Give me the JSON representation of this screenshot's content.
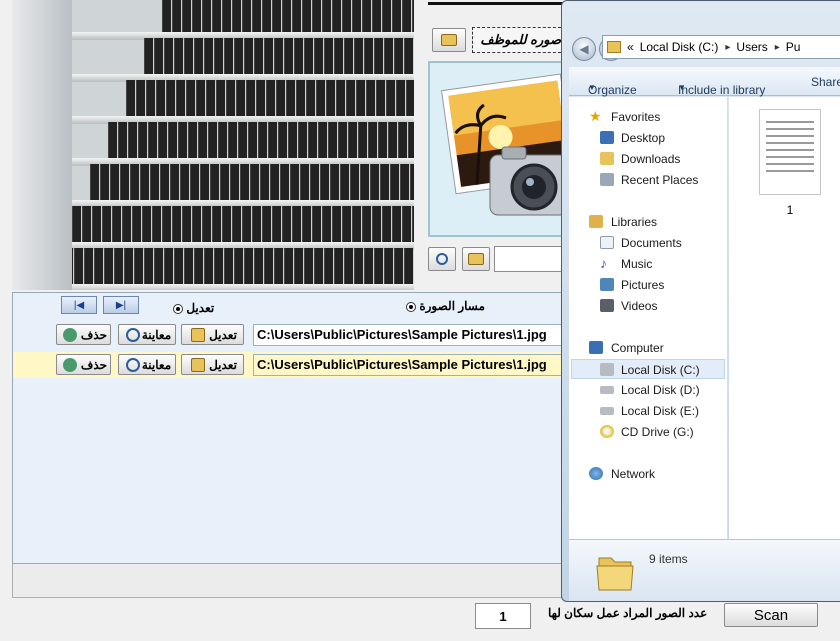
{
  "app": {
    "caption_text": "صوره للموظف",
    "nav_first": "|◀",
    "nav_last": "▶|",
    "radio_edit_label": "تعديل",
    "radio_path_label": "مسار الصورة",
    "rows": [
      {
        "edit": "تعديل",
        "preview": "معاينة",
        "delete": "حذف",
        "path": "C:\\Users\\Public\\Pictures\\Sample Pictures\\1.jpg"
      },
      {
        "edit": "تعديل",
        "preview": "معاينة",
        "delete": "حذف",
        "path": "C:\\Users\\Public\\Pictures\\Sample Pictures\\1.jpg"
      }
    ],
    "scan_count_label": "عدد الصور المراد عمل سكان لها",
    "scan_count_value": "1",
    "scan_button": "Scan"
  },
  "explorer": {
    "address": {
      "prefix": "«",
      "segments": [
        "Local Disk (C:)",
        "Users",
        "Pu"
      ]
    },
    "toolbar": {
      "organize": "Organize",
      "include_in_library": "Include in library",
      "share": "Share"
    },
    "nav": {
      "favorites": "Favorites",
      "favorites_items": [
        "Desktop",
        "Downloads",
        "Recent Places"
      ],
      "libraries": "Libraries",
      "libraries_items": [
        "Documents",
        "Music",
        "Pictures",
        "Videos"
      ],
      "computer": "Computer",
      "computer_items": [
        "Local Disk (C:)",
        "Local Disk (D:)",
        "Local Disk (E:)",
        "CD Drive (G:)"
      ],
      "network": "Network"
    },
    "file": {
      "label": "1"
    },
    "status": {
      "items": "9 items"
    },
    "colors": {
      "selection": "#e3edf9",
      "frame": "#c2d4e6"
    }
  }
}
